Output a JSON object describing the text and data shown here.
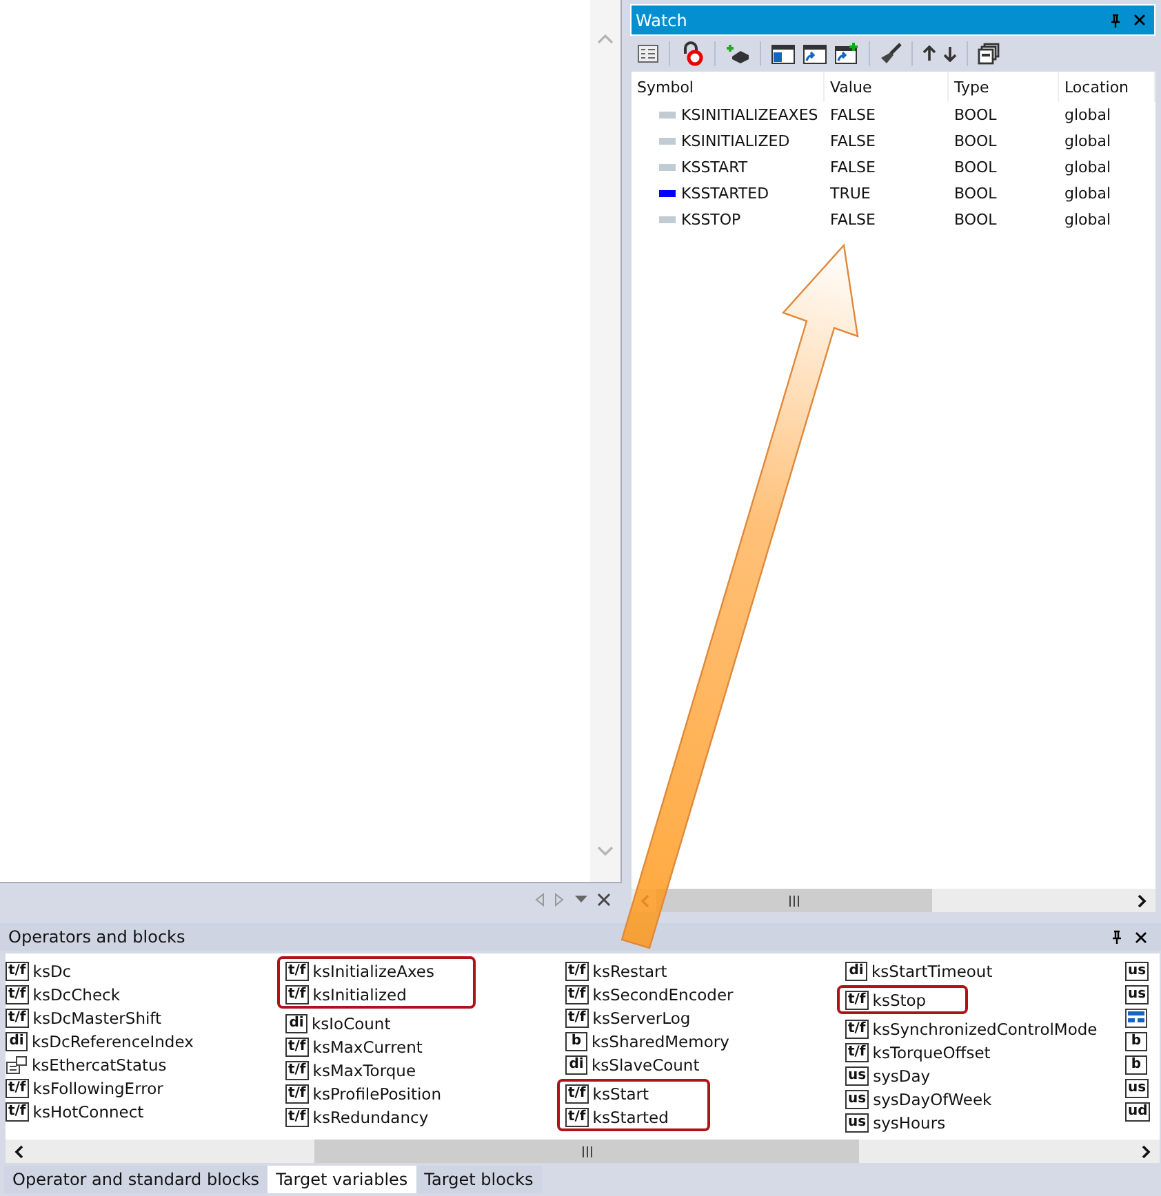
{
  "watch": {
    "title": "Watch",
    "columns": [
      "Symbol",
      "Value",
      "Type",
      "Location"
    ],
    "rows": [
      {
        "symbol": "KSINITIALIZEAXES",
        "value": "FALSE",
        "type": "BOOL",
        "location": "global",
        "color": "#c0cbd2"
      },
      {
        "symbol": "KSINITIALIZED",
        "value": "FALSE",
        "type": "BOOL",
        "location": "global",
        "color": "#c0cbd2"
      },
      {
        "symbol": "KSSTART",
        "value": "FALSE",
        "type": "BOOL",
        "location": "global",
        "color": "#c0cbd2"
      },
      {
        "symbol": "KSSTARTED",
        "value": "TRUE",
        "type": "BOOL",
        "location": "global",
        "color": "#0000ff"
      },
      {
        "symbol": "KSSTOP",
        "value": "FALSE",
        "type": "BOOL",
        "location": "global",
        "color": "#c0cbd2"
      }
    ]
  },
  "operators": {
    "title": "Operators and blocks",
    "columns": [
      [
        {
          "highlighted": false,
          "items": [
            {
              "badge": "t/f",
              "name": "ksDc"
            },
            {
              "badge": "t/f",
              "name": "ksDcCheck"
            },
            {
              "badge": "t/f",
              "name": "ksDcMasterShift"
            },
            {
              "badge": "di",
              "name": "ksDcReferenceIndex"
            },
            {
              "kind": "struct",
              "name": "ksEthercatStatus"
            },
            {
              "badge": "t/f",
              "name": "ksFollowingError"
            },
            {
              "badge": "t/f",
              "name": "ksHotConnect"
            }
          ]
        }
      ],
      [
        {
          "highlighted": true,
          "items": [
            {
              "badge": "t/f",
              "name": "ksInitializeAxes"
            },
            {
              "badge": "t/f",
              "name": "ksInitialized"
            }
          ]
        },
        {
          "highlighted": false,
          "items": [
            {
              "badge": "di",
              "name": "ksIoCount"
            },
            {
              "badge": "t/f",
              "name": "ksMaxCurrent"
            },
            {
              "badge": "t/f",
              "name": "ksMaxTorque"
            },
            {
              "badge": "t/f",
              "name": "ksProfilePosition"
            },
            {
              "badge": "t/f",
              "name": "ksRedundancy"
            }
          ]
        }
      ],
      [
        {
          "highlighted": false,
          "items": [
            {
              "badge": "t/f",
              "name": "ksRestart"
            },
            {
              "badge": "t/f",
              "name": "ksSecondEncoder"
            },
            {
              "badge": "t/f",
              "name": "ksServerLog"
            },
            {
              "badge": "b",
              "name": "ksSharedMemory"
            },
            {
              "badge": "di",
              "name": "ksSlaveCount"
            }
          ]
        },
        {
          "highlighted": true,
          "items": [
            {
              "badge": "t/f",
              "name": "ksStart"
            },
            {
              "badge": "t/f",
              "name": "ksStarted"
            }
          ]
        }
      ],
      [
        {
          "highlighted": false,
          "items": [
            {
              "badge": "di",
              "name": "ksStartTimeout"
            }
          ]
        },
        {
          "highlighted": true,
          "items": [
            {
              "badge": "t/f",
              "name": "ksStop"
            }
          ]
        },
        {
          "highlighted": false,
          "items": [
            {
              "badge": "t/f",
              "name": "ksSynchronizedControlMode"
            },
            {
              "badge": "t/f",
              "name": "ksTorqueOffset"
            },
            {
              "badge": "us",
              "name": "sysDay"
            },
            {
              "badge": "us",
              "name": "sysDayOfWeek"
            },
            {
              "badge": "us",
              "name": "sysHours"
            }
          ]
        }
      ],
      [
        {
          "highlighted": false,
          "items": [
            {
              "badge": "us"
            },
            {
              "badge": "us"
            },
            {
              "kind": "table"
            },
            {
              "badge": "b"
            },
            {
              "badge": "b"
            },
            {
              "badge": "us"
            },
            {
              "badge": "ud"
            }
          ]
        }
      ]
    ],
    "tabs": [
      {
        "label": "Operator and standard blocks",
        "selected": false
      },
      {
        "label": "Target variables",
        "selected": true
      },
      {
        "label": "Target blocks",
        "selected": false
      }
    ]
  }
}
